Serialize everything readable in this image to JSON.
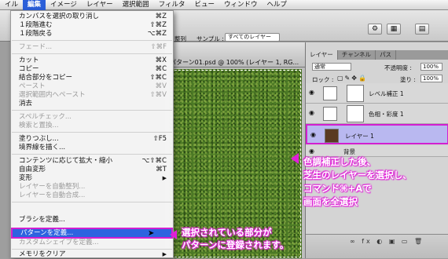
{
  "menubar": {
    "items": [
      "イル",
      "編集",
      "イメージ",
      "レイヤー",
      "選択範囲",
      "フィルタ",
      "ビュー",
      "ウィンドウ",
      "ヘルプ"
    ]
  },
  "optionsbar": {
    "modify_label": "整列",
    "sample_label": "サンプル :",
    "sample_value": "すべてのレイヤー"
  },
  "document": {
    "tab_title": "パターン01.psd @ 100% (レイヤー 1, RG..."
  },
  "edit_menu": {
    "items": [
      {
        "label": "カンバスを選択の取り消し",
        "shortcut": "⌘Z",
        "disabled": false
      },
      {
        "label": "１段階進む",
        "shortcut": "⇧⌘Z",
        "disabled": false
      },
      {
        "label": "１段階戻る",
        "shortcut": "⌥⌘Z",
        "disabled": false
      },
      {
        "label": "フェード...",
        "shortcut": "⇧⌘F",
        "disabled": true
      },
      {
        "label": "カット",
        "shortcut": "⌘X",
        "disabled": false
      },
      {
        "label": "コピー",
        "shortcut": "⌘C",
        "disabled": false
      },
      {
        "label": "結合部分をコピー",
        "shortcut": "⇧⌘C",
        "disabled": false
      },
      {
        "label": "ペースト",
        "shortcut": "⌘V",
        "disabled": true
      },
      {
        "label": "選択範囲内へペースト",
        "shortcut": "⇧⌘V",
        "disabled": true
      },
      {
        "label": "消去",
        "shortcut": "",
        "disabled": false
      },
      {
        "label": "スペルチェック...",
        "shortcut": "",
        "disabled": true
      },
      {
        "label": "検索と置換...",
        "shortcut": "",
        "disabled": true
      },
      {
        "label": "塗りつぶし...",
        "shortcut": "⇧F5",
        "disabled": false
      },
      {
        "label": "境界線を描く...",
        "shortcut": "",
        "disabled": false
      },
      {
        "label": "コンテンツに応じて拡大・縮小",
        "shortcut": "⌥⇧⌘C",
        "disabled": false
      },
      {
        "label": "自由変形",
        "shortcut": "⌘T",
        "disabled": false
      },
      {
        "label": "変形",
        "shortcut": "▶",
        "disabled": false
      },
      {
        "label": "レイヤーを自動整列...",
        "shortcut": "",
        "disabled": true
      },
      {
        "label": "レイヤーを自動合成...",
        "shortcut": "",
        "disabled": true
      },
      {
        "label": "ブラシを定義...",
        "shortcut": "",
        "disabled": false
      },
      {
        "label": "パターンを定義...",
        "shortcut": "",
        "disabled": false
      },
      {
        "label": "カスタムシェイプを定義...",
        "shortcut": "",
        "disabled": true
      },
      {
        "label": "メモリをクリア",
        "shortcut": "▶",
        "disabled": false
      }
    ]
  },
  "layers_panel": {
    "tabs": [
      "レイヤー",
      "チャンネル",
      "パス"
    ],
    "blend_mode": "通常",
    "opacity_label": "不透明度 :",
    "opacity_value": "100%",
    "lock_label": "ロック :",
    "fill_label": "塗り :",
    "fill_value": "100%",
    "layers": [
      {
        "name": "レベル補正 1"
      },
      {
        "name": "色相・彩度 1"
      },
      {
        "name": "レイヤー 1"
      },
      {
        "name": "背景"
      }
    ]
  },
  "annotations": {
    "right_lines": [
      "色調補正した後、",
      "芝生のレイヤーを選択し、",
      "コマンド⌘+Aで",
      "画面を全選択"
    ],
    "bottom_lines": [
      "選択されている部分が",
      "パターンに登録されます。"
    ],
    "color": "#e01fd8"
  }
}
